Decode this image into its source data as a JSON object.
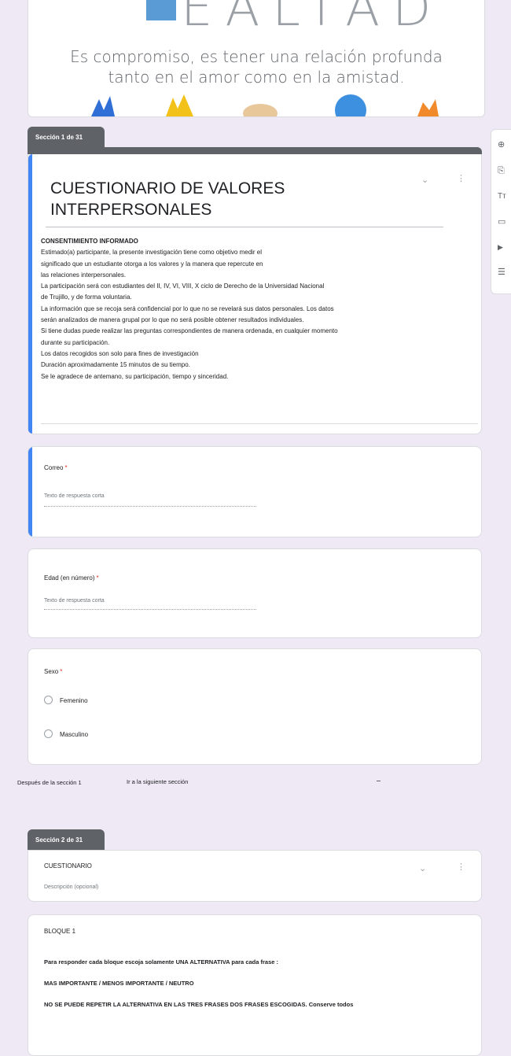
{
  "banner": {
    "word": "EALTAD",
    "line1": "Es compromiso, es tener una relación profunda",
    "line2": "tanto en el amor como en la amistad."
  },
  "section1": {
    "tab_label": "Sección 1 de 31",
    "title_line1": "CUESTIONARIO  DE VALORES",
    "title_line2": "INTERPERSONALES",
    "description": [
      "CONSENTIMIENTO INFORMADO",
      "Estimado(a) participante, la presente investigación tiene como objetivo medir el",
      "significado  que un estudiante otorga a los valores y la manera que repercute en",
      "las relaciones interpersonales.",
      "La participación será con estudiantes del II, IV, VI, VIII, X ciclo de Derecho de la  Universidad Nacional",
      " de Trujillo, y de forma  voluntaria.",
      "La información que se recoja será confidencial por lo que no se revelará sus datos personales. Los datos",
      "serán analizados de manera grupal por lo que no  será posible obtener resultados individuales.",
      "Si tiene dudas puede realizar las preguntas correspondientes de manera ordenada, en cualquier momento",
      "durante su participación.",
      "Los datos recogidos son solo para fines de investigación",
      "Duración aproximadamente 15 minutos de su tiempo.",
      "Se le agradece de antemano, su  participación, tiempo y sinceridad."
    ]
  },
  "questions": {
    "correo": {
      "label": "Correo",
      "placeholder": "Texto de respuesta corta"
    },
    "edad": {
      "label": "Edad  (en número)",
      "placeholder": "Texto de respuesta corta"
    },
    "sexo": {
      "label": "Sexo",
      "options": [
        "Femenino",
        "Masculino"
      ]
    }
  },
  "after_section": {
    "label": "Después de la sección 1",
    "value": "Ir a la siguiente sección"
  },
  "section2": {
    "tab_label": "Sección 2 de 31",
    "title": "CUESTIONARIO",
    "description_placeholder": "Descripción (opcional)"
  },
  "block1": {
    "title": "BLOQUE 1",
    "line1": "Para responder cada bloque escoja solamente UNA ALTERNATIVA  para cada frase :",
    "line2": "MAS IMPORTANTE   / MENOS IMPORTANTE  /  NEUTRO",
    "line3": "NO  SE PUEDE REPETIR LA ALTERNATIVA EN LAS TRES FRASES DOS FRASES ESCOGIDAS. Conserve todos"
  },
  "toolbar_icons": [
    "add-question-icon",
    "import-questions-icon",
    "add-title-icon",
    "add-image-icon",
    "add-video-icon",
    "add-section-icon"
  ],
  "toolbar_glyphs": [
    "⊕",
    "⎘",
    "Tт",
    "▭",
    "▶",
    "☰"
  ],
  "colors": {
    "accent": "#4285f4",
    "section_tab": "#5f6368",
    "required": "#d93025",
    "page_bg": "#efe9f6"
  }
}
